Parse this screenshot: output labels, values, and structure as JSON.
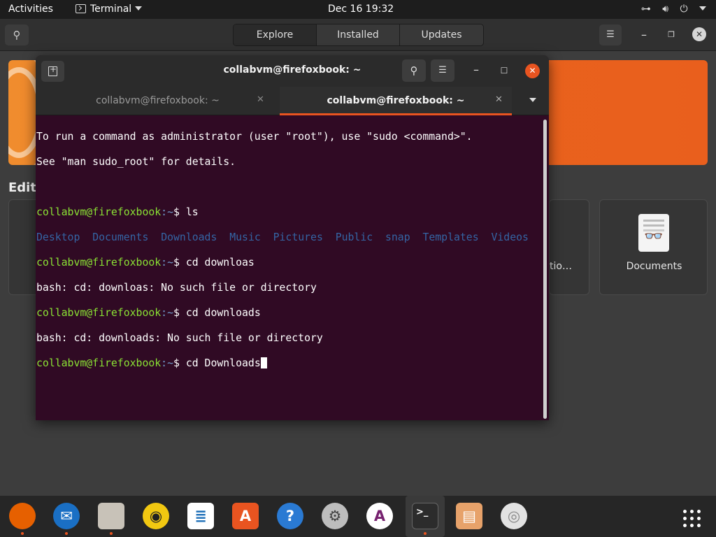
{
  "topbar": {
    "activities": "Activities",
    "app_name": "Terminal",
    "clock": "Dec 16  19:32",
    "tray_icons": [
      "network-icon",
      "volume-icon",
      "power-icon",
      "chevron-down-icon"
    ]
  },
  "software": {
    "tabs": [
      "Explore",
      "Installed",
      "Updates"
    ],
    "active_tab": "Explore",
    "section_partial": "Edito",
    "card_partial": "tio…",
    "docs_card_label": "Documents"
  },
  "terminal": {
    "title": "collabvm@firefoxbook: ~",
    "tabs": [
      {
        "label": "collabvm@firefoxbook: ~"
      },
      {
        "label": "collabvm@firefoxbook: ~"
      }
    ],
    "motd": [
      "To run a command as administrator (user \"root\"), use \"sudo <command>\".",
      "See \"man sudo_root\" for details."
    ],
    "prompt_user": "collabvm@firefoxbook",
    "prompt_path": ":~",
    "prompt_sym": "$ ",
    "cmd1": "ls",
    "ls_output": [
      "Desktop",
      "Documents",
      "Downloads",
      "Music",
      "Pictures",
      "Public",
      "snap",
      "Templates",
      "Videos"
    ],
    "cmd2": "cd downloas",
    "err1": "bash: cd: downloas: No such file or directory",
    "cmd3": "cd downloads",
    "err2": "bash: cd: downloads: No such file or directory",
    "cmd4": "cd Downloads"
  },
  "dock": [
    {
      "name": "firefox-icon",
      "glyph": "",
      "bg": "#e66000",
      "fg": "#ffcc33"
    },
    {
      "name": "thunderbird-icon",
      "glyph": "✉",
      "bg": "#1a6fc4",
      "fg": "#ffffff"
    },
    {
      "name": "files-icon",
      "glyph": "",
      "bg": "#c8c2b8",
      "fg": "#555"
    },
    {
      "name": "rhythmbox-icon",
      "glyph": "◉",
      "bg": "#f2c811",
      "fg": "#222"
    },
    {
      "name": "writer-icon",
      "glyph": "≣",
      "bg": "#ffffff",
      "fg": "#1e6fb8"
    },
    {
      "name": "software-center-icon",
      "glyph": "A",
      "bg": "#e95420",
      "fg": "#ffffff"
    },
    {
      "name": "help-icon",
      "glyph": "?",
      "bg": "#2a7ad3",
      "fg": "#ffffff"
    },
    {
      "name": "settings-icon",
      "glyph": "⚙",
      "bg": "#bdbdbd",
      "fg": "#444"
    },
    {
      "name": "app-launcher-icon",
      "glyph": "A",
      "bg": "#ffffff",
      "fg": "#77216f"
    },
    {
      "name": "terminal-icon",
      "glyph": ">_",
      "bg": "#2c2c2c",
      "fg": "#ffffff"
    },
    {
      "name": "archive-icon",
      "glyph": "▤",
      "bg": "#e7a26a",
      "fg": "#fff"
    },
    {
      "name": "disc-icon",
      "glyph": "◎",
      "bg": "#e2e2e2",
      "fg": "#888"
    }
  ]
}
